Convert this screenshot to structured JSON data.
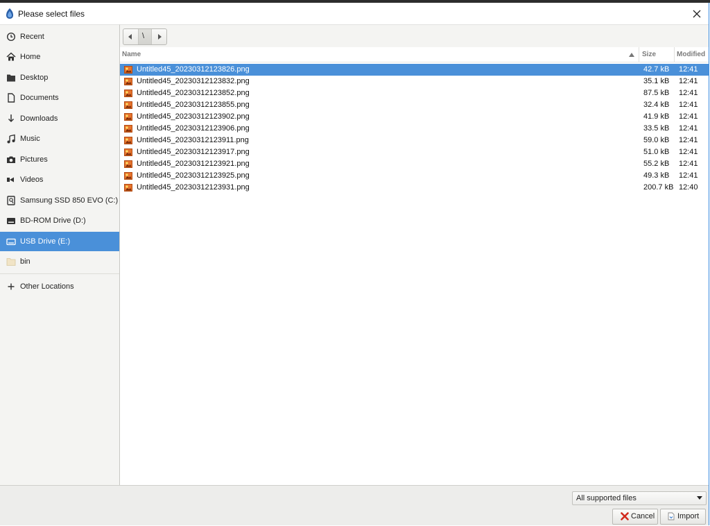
{
  "dialog": {
    "title": "Please select files"
  },
  "sidebar": {
    "items": [
      {
        "label": "Recent",
        "icon": "clock-icon"
      },
      {
        "label": "Home",
        "icon": "home-icon"
      },
      {
        "label": "Desktop",
        "icon": "folder-icon"
      },
      {
        "label": "Documents",
        "icon": "document-icon"
      },
      {
        "label": "Downloads",
        "icon": "download-arrow-icon"
      },
      {
        "label": "Music",
        "icon": "music-note-icon"
      },
      {
        "label": "Pictures",
        "icon": "camera-icon"
      },
      {
        "label": "Videos",
        "icon": "video-icon"
      },
      {
        "label": "Samsung SSD 850 EVO (C:)",
        "icon": "hard-drive-icon"
      },
      {
        "label": "BD-ROM Drive (D:)",
        "icon": "optical-drive-icon"
      },
      {
        "label": "USB Drive (E:)",
        "icon": "usb-drive-icon",
        "selected": true
      },
      {
        "label": "bin",
        "icon": "folder-icon"
      },
      {
        "label": "Other Locations",
        "icon": "plus-icon"
      }
    ]
  },
  "pathbar": {
    "current": "\\"
  },
  "file_list": {
    "columns": {
      "name": "Name",
      "size": "Size",
      "modified": "Modified"
    },
    "sort": "ascending",
    "rows": [
      {
        "name": "Untitled45_20230312123826.png",
        "size": "42.7 kB",
        "modified": "12:41",
        "selected": true
      },
      {
        "name": "Untitled45_20230312123832.png",
        "size": "35.1 kB",
        "modified": "12:41"
      },
      {
        "name": "Untitled45_20230312123852.png",
        "size": "87.5 kB",
        "modified": "12:41"
      },
      {
        "name": "Untitled45_20230312123855.png",
        "size": "32.4 kB",
        "modified": "12:41"
      },
      {
        "name": "Untitled45_20230312123902.png",
        "size": "41.9 kB",
        "modified": "12:41"
      },
      {
        "name": "Untitled45_20230312123906.png",
        "size": "33.5 kB",
        "modified": "12:41"
      },
      {
        "name": "Untitled45_20230312123911.png",
        "size": "59.0 kB",
        "modified": "12:41"
      },
      {
        "name": "Untitled45_20230312123917.png",
        "size": "51.0 kB",
        "modified": "12:41"
      },
      {
        "name": "Untitled45_20230312123921.png",
        "size": "55.2 kB",
        "modified": "12:41"
      },
      {
        "name": "Untitled45_20230312123925.png",
        "size": "49.3 kB",
        "modified": "12:41"
      },
      {
        "name": "Untitled45_20230312123931.png",
        "size": "200.7 kB",
        "modified": "12:40"
      }
    ]
  },
  "footer": {
    "filter_selected": "All supported files",
    "cancel_label": "Cancel",
    "import_label": "Import"
  },
  "colors": {
    "selection": "#4a90d9",
    "sidebar_bg": "#f4f4f2",
    "footer_bg": "#ededeb"
  }
}
